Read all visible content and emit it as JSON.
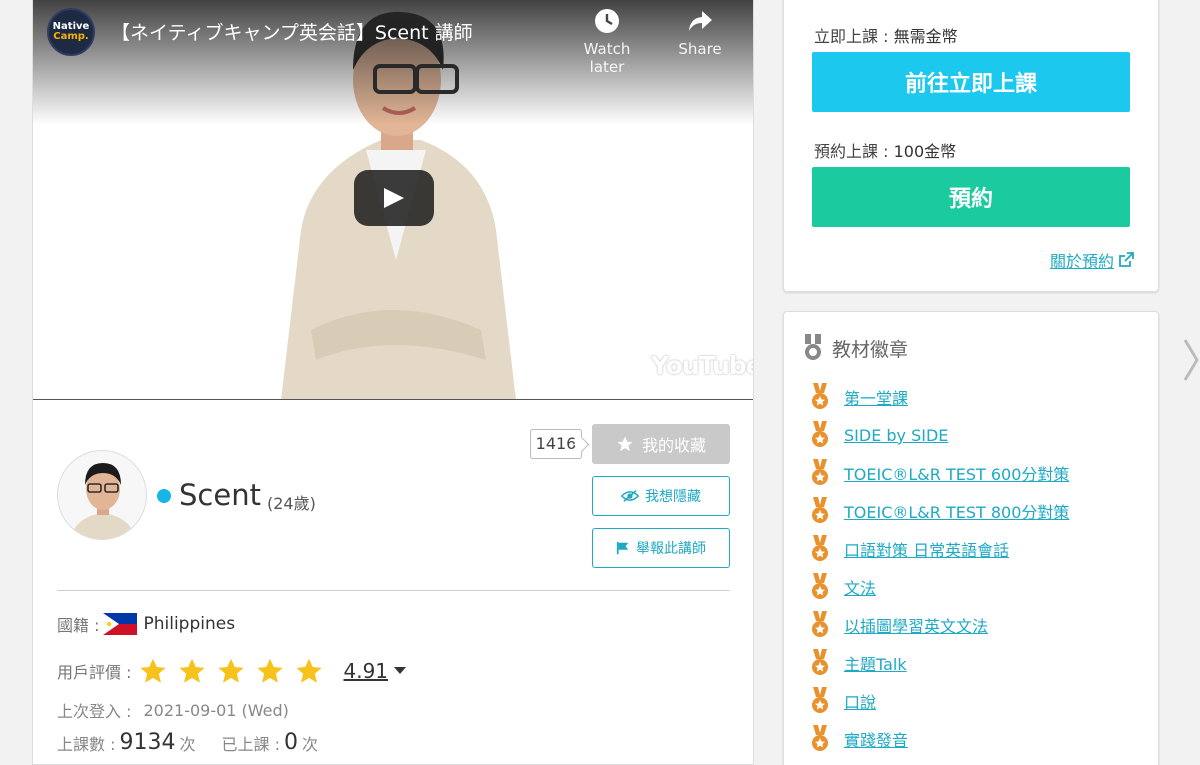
{
  "video": {
    "title": "【ネイティブキャンプ英会話】Scent 講師",
    "channel_logo_line1": "Native",
    "channel_logo_line2": "Camp.",
    "watch_later_label": "Watch later",
    "share_label": "Share",
    "watermark": "YouTube"
  },
  "profile": {
    "favorite_count": "1416",
    "favorite_button": "我的收藏",
    "hide_button": "我想隱藏",
    "report_button": "舉報此講師",
    "name": "Scent",
    "age": "(24歲)",
    "nationality_label": "國籍 :",
    "nationality_value": "Philippines",
    "rating_label": "用戶評價 :",
    "rating_value": "4.91",
    "rating_stars": 5,
    "last_login_label": "上次登入 :",
    "last_login_value": "2021-09-01 (Wed)",
    "lessons_label": "上課數 :",
    "lessons_value": "9134",
    "lessons_unit": "次",
    "taken_label": "已上課 :",
    "taken_value": "0",
    "taken_unit": "次"
  },
  "booking": {
    "instant_label": "立即上課 :",
    "instant_price": "無需金幣",
    "instant_button": "前往立即上課",
    "reserve_label": "預約上課 :",
    "reserve_price": "100金幣",
    "reserve_button": "預約",
    "about_link": "關於預約"
  },
  "badges": {
    "title": "教材徽章",
    "items": [
      "第一堂課",
      "SIDE by SIDE",
      "TOEIC®L&R TEST 600分對策",
      "TOEIC®L&R TEST 800分對策",
      "口語對策 日常英語會話",
      "文法",
      "以插圖學習英文文法",
      "主題Talk",
      "口說",
      "實踐發音"
    ]
  },
  "colors": {
    "cyan": "#1cc8ee",
    "green": "#1ccaa0",
    "link": "#1ea9c4",
    "star": "#f7c21b",
    "badge": "#e8912d",
    "online": "#19b5e6"
  }
}
